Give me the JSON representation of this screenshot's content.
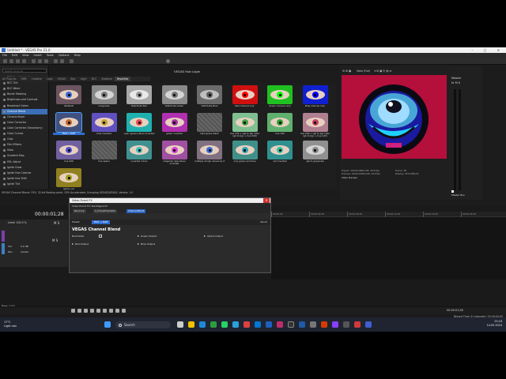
{
  "window": {
    "title": "Untitled * - VEGAS Pro 21.0"
  },
  "menu": [
    "File",
    "Edit",
    "View",
    "Insert",
    "Tools",
    "Options",
    "Help"
  ],
  "toolbar": {
    "hub_label": "VEGAS Hub Login"
  },
  "fx_search_placeholder": "Search plug-ins",
  "fx_list": [
    "BCC Hue Sat Lightness",
    "BCC Tint",
    "BCC Wave",
    "Bezier Masking",
    "Brightness and Contrast",
    "Broadcast Colors",
    "Channel Blend",
    "Chroma Keyer",
    "Color Corrector",
    "Color Corrector (Secondary)",
    "Color Curves",
    "Crop",
    "Film Effects",
    "Glow",
    "Gradient Map",
    "HSL Adjust",
    "Ignite Grow",
    "Ignite Hue Colorize",
    "Ignite Hue Shift",
    "Ignite Tint"
  ],
  "fx_selected": "Channel Blend",
  "tabs": [
    "All Plug-ins",
    "HDR",
    "Creative",
    "Look",
    "VEGAS",
    "Blur",
    "Light",
    "BCC",
    "Stabilize",
    "Favorites"
  ],
  "presets": [
    {
      "label": "(Default)",
      "c": "#3a6cd0",
      "bg": "#6b5560",
      "filter": "none"
    },
    {
      "label": "Grayscale",
      "c": "#777",
      "bg": "#888",
      "filter": "grayscale(1)"
    },
    {
      "label": "Distribute Red",
      "c": "#888",
      "bg": "#999",
      "filter": "grayscale(1) brightness(1.1)"
    },
    {
      "label": "Distribute Green",
      "c": "#777",
      "bg": "#8a8a8a",
      "filter": "grayscale(1)"
    },
    {
      "label": "Distribute Blue",
      "c": "#666",
      "bg": "#777",
      "filter": "grayscale(1) brightness(.9)"
    },
    {
      "label": "Red channel only",
      "c": "#f00",
      "bg": "#d01010",
      "filter": "none"
    },
    {
      "label": "Green channel only",
      "c": "#0f0",
      "bg": "#20c020",
      "filter": "none"
    },
    {
      "label": "Blue channel only",
      "c": "#00f",
      "bg": "#1020d0",
      "filter": "none"
    },
    {
      "label": "BGR → RGB",
      "c": "#c06a30",
      "bg": "#405080",
      "filter": "none"
    },
    {
      "label": "blue inverted",
      "c": "#c0a030",
      "bg": "#6050c0",
      "filter": "none"
    },
    {
      "label": "cyan (green+blue) inverted",
      "c": "#e05050",
      "bg": "#20b0b0",
      "filter": "none"
    },
    {
      "label": "green inverted",
      "c": "#a030a0",
      "bg": "#b030b0",
      "filter": "none"
    },
    {
      "label": "hsla space blank",
      "c": "#888",
      "bg": "#555",
      "filter": "none"
    },
    {
      "label": "hue 120 + rgb to bgr (also rgb to bgr + hue 240)",
      "c": "#40a040",
      "bg": "#80c090",
      "filter": "none"
    },
    {
      "label": "hue 120",
      "c": "#30a030",
      "bg": "#60b070",
      "filter": "none"
    },
    {
      "label": "hue 240 + rgb to bgr (also rgb to bgr + hue 120)",
      "c": "#c04060",
      "bg": "#b08090",
      "filter": "none"
    },
    {
      "label": "hue 240",
      "c": "#5050d0",
      "bg": "#7060a0",
      "filter": "none"
    },
    {
      "label": "hue space",
      "c": "#888",
      "bg": "#555",
      "filter": "none"
    },
    {
      "label": "inverted colors",
      "c": "#40c0c0",
      "bg": "#409090",
      "filter": "none"
    },
    {
      "label": "magenta (red+blue) inverted",
      "c": "#d040d0",
      "bg": "#a050a0",
      "filter": "none"
    },
    {
      "label": "multiply all rgb values by 2",
      "c": "#3a6cd0",
      "bg": "#807080",
      "filter": "none"
    },
    {
      "label": "only green and blue",
      "c": "#30a0b0",
      "bg": "#40908a",
      "filter": "none"
    },
    {
      "label": "red inverted",
      "c": "#30c0a0",
      "bg": "#309090",
      "filter": "none"
    },
    {
      "label": "rgb to grayscale",
      "c": "#888",
      "bg": "#909090",
      "filter": "grayscale(1)"
    },
    {
      "label": "rgb to yuv",
      "c": "#a0a020",
      "bg": "#908020",
      "filter": "none"
    }
  ],
  "status_line": "VEGAS Channel Blend: OFX, 32-bit floating point, GPU Accelerated, Grouping VEGAS\\VEGAS, Version 1.0",
  "status_line2": "Description: From Magix Computer Products Intl. Co.",
  "preview": {
    "quality": "Best (Full)",
    "project": "Project: 1920x1080x128, 29.970p",
    "preview_res": "Preview: 1920x1080x128, 29.970p",
    "frame": "Frame: 38",
    "display": "Display: 457x258x32",
    "tab": "Video Preview"
  },
  "master": {
    "label": "Master",
    "fx": "fx",
    "ms": "M S",
    "bus": "Master Bus"
  },
  "fx_dialog": {
    "title": "Video Event FX",
    "event": "Video Event FX: blackbgowmf",
    "chain": [
      "Pan/Crop",
      "0_VirtualFrameSte",
      "Channel Blend"
    ],
    "preset_label": "Preset:",
    "preset_value": "BGR → RGB",
    "about": "About",
    "plugin_name": "VEGAS Channel Blend",
    "normalize": "Normalize",
    "red_output": "Red Output",
    "green_output": "Green Output",
    "blue_output": "Blue Output",
    "alpha_output": "Alpha Output"
  },
  "timeline": {
    "time": "00:00:01;28",
    "track_level": "Level: 100.0 %",
    "vol": "Vol:",
    "vol_value": "0.0 dB",
    "pan": "Pan:",
    "pan_value": "Center",
    "rate": "Rate: 0.00",
    "ruler": [
      "00:00:00",
      "00:00:04;29",
      "00:00:09;29",
      "00:00:14;29",
      "00:00:19;29",
      "00:00:24;29"
    ]
  },
  "transport_time": "00:00:01;28",
  "record_time": "Record Time (2 channels): 33:18:40:05",
  "taskbar": {
    "weather_temp": "17°C",
    "weather_text": "Light rain",
    "search": "Search",
    "clock": "23:16",
    "date": "14.05.2024"
  }
}
